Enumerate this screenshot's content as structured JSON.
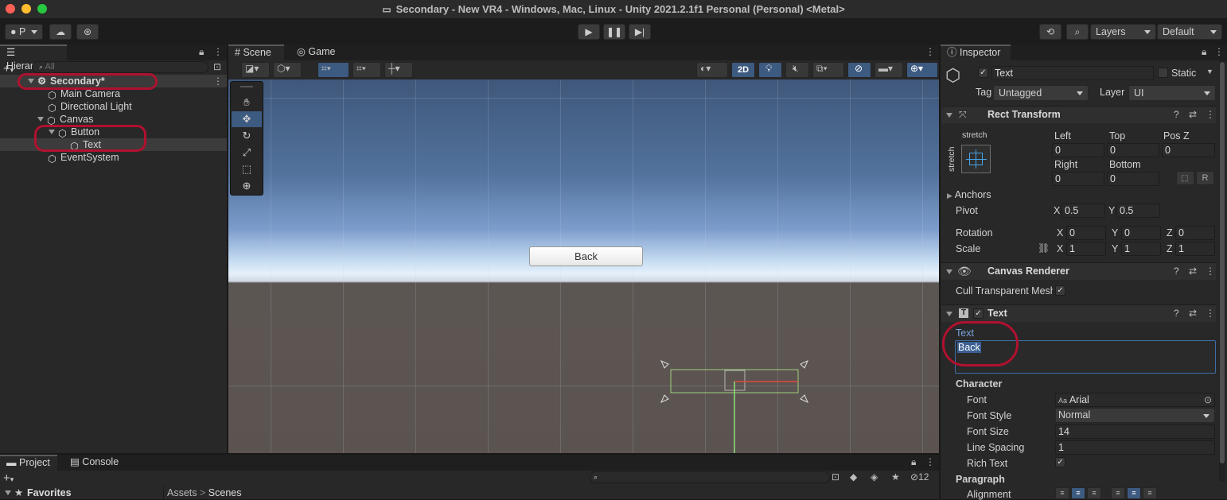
{
  "window": {
    "title": "Secondary - New VR4 - Windows, Mac, Linux - Unity 2021.2.1f1 Personal (Personal) <Metal>"
  },
  "toolbar": {
    "account": "P",
    "layers": "Layers",
    "layout": "Default"
  },
  "hierarchy": {
    "tab": "Hierarchy",
    "search_placeholder": "All",
    "items": [
      {
        "label": "Secondary*"
      },
      {
        "label": "Main Camera"
      },
      {
        "label": "Directional Light"
      },
      {
        "label": "Canvas"
      },
      {
        "label": "Button"
      },
      {
        "label": "Text"
      },
      {
        "label": "EventSystem"
      }
    ]
  },
  "scene": {
    "tabs": [
      "Scene",
      "Game"
    ],
    "mode_2d": "2D",
    "button_label": "Back"
  },
  "inspector": {
    "tab": "Inspector",
    "object_name": "Text",
    "static_label": "Static",
    "tag_label": "Tag",
    "tag_value": "Untagged",
    "layer_label": "Layer",
    "layer_value": "UI",
    "rect_transform": {
      "title": "Rect Transform",
      "stretch_top": "stretch",
      "stretch_side": "stretch",
      "left_label": "Left",
      "left": "0",
      "top_label": "Top",
      "top": "0",
      "posz_label": "Pos Z",
      "posz": "0",
      "right_label": "Right",
      "right": "0",
      "bottom_label": "Bottom",
      "bottom": "0",
      "r_button": "R",
      "anchors": "Anchors",
      "pivot_label": "Pivot",
      "pivot_x": "0.5",
      "pivot_y": "0.5",
      "rotation_label": "Rotation",
      "rot_x": "0",
      "rot_y": "0",
      "rot_z": "0",
      "scale_label": "Scale",
      "scale_x": "1",
      "scale_y": "1",
      "scale_z": "1",
      "x": "X",
      "y": "Y",
      "z": "Z"
    },
    "canvas_renderer": {
      "title": "Canvas Renderer",
      "cull_label": "Cull Transparent Mesh"
    },
    "text_component": {
      "title": "Text",
      "text_label": "Text",
      "text_value": "Back",
      "character": "Character",
      "font_label": "Font",
      "font_value": "Arial",
      "font_style_label": "Font Style",
      "font_style_value": "Normal",
      "font_size_label": "Font Size",
      "font_size_value": "14",
      "line_spacing_label": "Line Spacing",
      "line_spacing_value": "1",
      "rich_text_label": "Rich Text",
      "paragraph": "Paragraph",
      "alignment_label": "Alignment"
    }
  },
  "bottom": {
    "tabs": [
      "Project",
      "Console"
    ],
    "favorites": "Favorites",
    "breadcrumb": [
      "Assets",
      "Scenes"
    ],
    "hidden_count": "12"
  },
  "colors": {
    "selection_ring": "#b0112f",
    "accent": "#3d6fa8",
    "bg": "#282828"
  }
}
